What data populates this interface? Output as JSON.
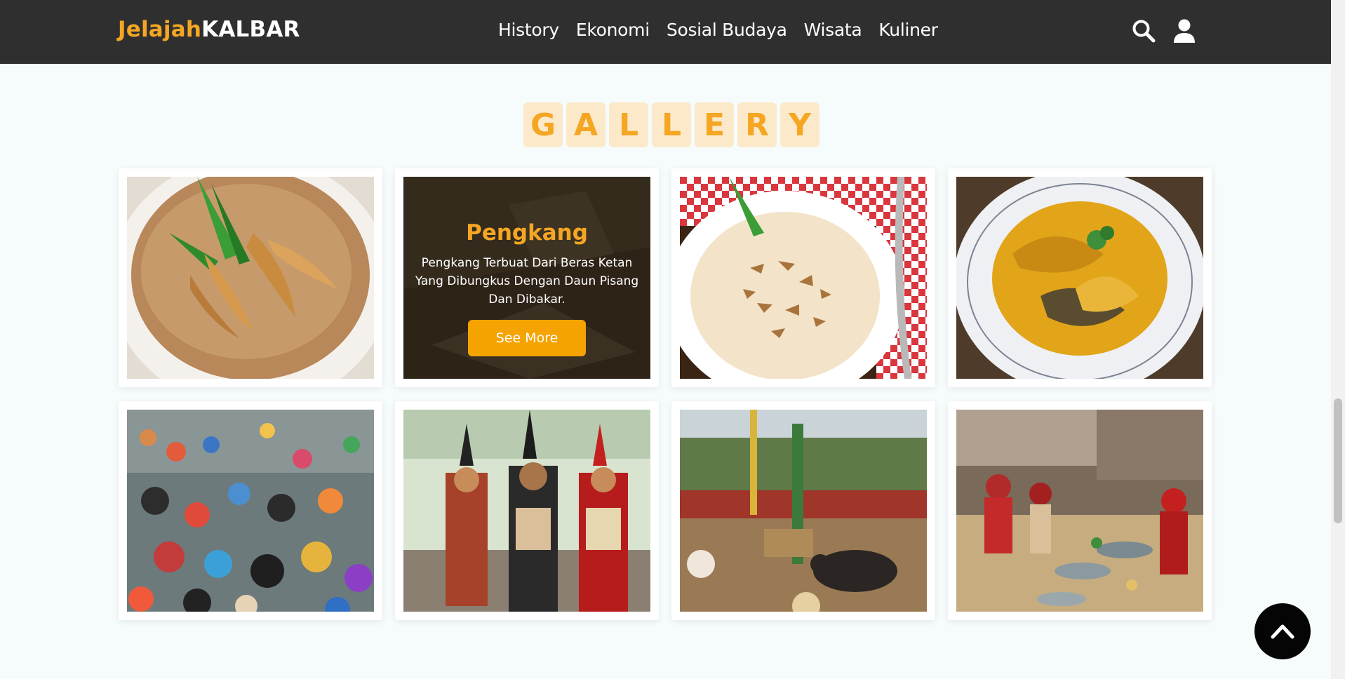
{
  "header": {
    "logo_part1": "Jelajah",
    "logo_part2": "KALBAR",
    "nav": [
      "History",
      "Ekonomi",
      "Sosial Budaya",
      "Wisata",
      "Kuliner"
    ],
    "icons": [
      "search-icon",
      "user-icon"
    ]
  },
  "gallery": {
    "title_letters": [
      "G",
      "A",
      "L",
      "L",
      "E",
      "R",
      "Y"
    ],
    "items": [
      {
        "image": "bubur-pedas-bowl-photo"
      },
      {
        "image": "pengkang-photo",
        "title": "Pengkang",
        "description": "Pengkang Terbuat Dari Beras Ketan Yang Dibungkus Dengan Daun Pisang Dan Dibakar.",
        "button": "See More"
      },
      {
        "image": "coconut-dessert-bowl-photo"
      },
      {
        "image": "yellow-fish-curry-photo"
      },
      {
        "image": "river-festival-crowd-photo"
      },
      {
        "image": "dayak-warriors-parade-photo"
      },
      {
        "image": "village-ceremony-buffalo-photo"
      },
      {
        "image": "traditional-ritual-offerings-photo"
      }
    ]
  },
  "colors": {
    "accent": "#f5a623",
    "header_bg": "#2f2f2f",
    "page_bg": "#f6fbfc"
  }
}
